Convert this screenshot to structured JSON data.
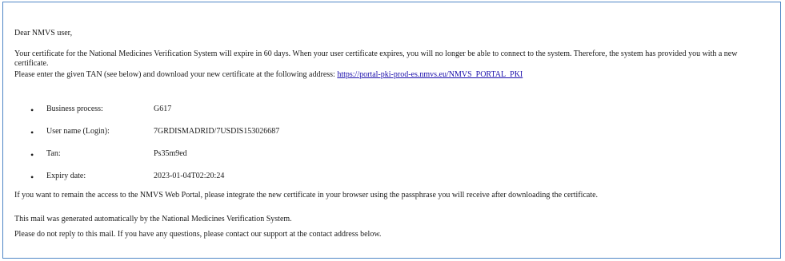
{
  "greeting": "Dear NMVS user,",
  "para1": "Your certificate for the National Medicines Verification System will expire in 60 days. When your user certificate expires, you will no longer be able to connect to the system. Therefore, the system has provided you with a new certificate.",
  "para2_prefix": "Please enter the given TAN (see below) and download your new certificate at the following address:",
  "portal_link": "https://portal-pki-prod-es.nmvs.eu/NMVS_PORTAL_PKI",
  "details": [
    {
      "label": "Business process:",
      "value": "G617"
    },
    {
      "label": "User name (Login):",
      "value": "7GRDISMADRID/7USDIS153026687"
    },
    {
      "label": "Tan:",
      "value": "Ps35m9ed"
    },
    {
      "label": "Expiry date:",
      "value": "2023-01-04T02:20:24"
    }
  ],
  "bullet_glyph": "•",
  "para3": "If you want to remain the access to the NMVS Web Portal, please integrate the new certificate in your browser using the passphrase you will receive after downloading the certificate.",
  "para4": "This mail was generated automatically by the National Medicines Verification System.",
  "para5": "Please do not reply to this mail. If you have any questions, please contact our support at the contact address below."
}
